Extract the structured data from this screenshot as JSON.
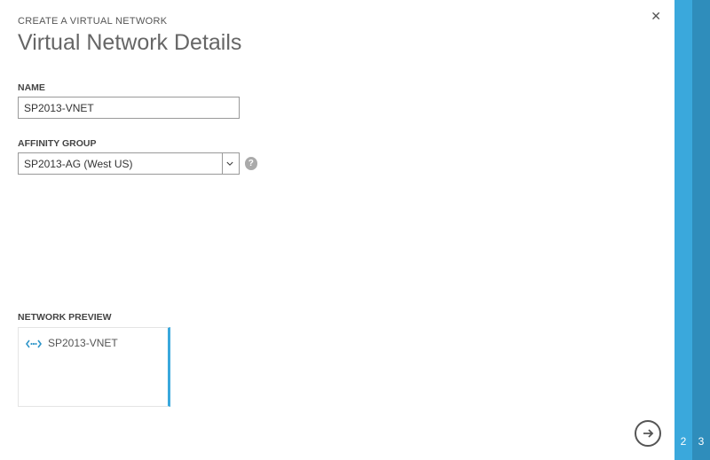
{
  "breadcrumb": "CREATE A VIRTUAL NETWORK",
  "pageTitle": "Virtual Network Details",
  "fields": {
    "name": {
      "label": "NAME",
      "value": "SP2013-VNET"
    },
    "affinity": {
      "label": "AFFINITY GROUP",
      "selected": "SP2013-AG (West US)"
    }
  },
  "preview": {
    "label": "NETWORK PREVIEW",
    "name": "SP2013-VNET"
  },
  "help": "?",
  "steps": {
    "s2": "2",
    "s3": "3"
  }
}
